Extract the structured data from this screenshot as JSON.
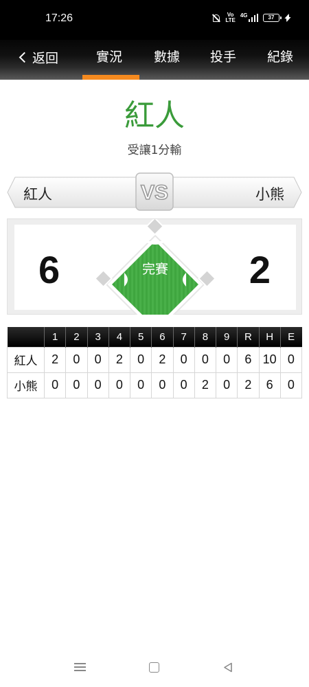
{
  "status_bar": {
    "time": "17:26",
    "volte_top": "Vo",
    "volte_bottom": "LTE",
    "network": "4G",
    "battery": "37"
  },
  "nav": {
    "back_label": "返回",
    "tabs": [
      {
        "label": "實況",
        "active": true
      },
      {
        "label": "數據",
        "active": false
      },
      {
        "label": "投手",
        "active": false
      },
      {
        "label": "紀錄",
        "active": false
      }
    ],
    "accent_color": "#f58a1f"
  },
  "game": {
    "winner": "紅人",
    "result_text": "受讓1分輸",
    "home_team": "紅人",
    "away_team": "小熊",
    "vs_label": "VS",
    "home_score": "6",
    "away_score": "2",
    "status": "完賽",
    "winner_color": "#3a9b3a",
    "field_color": "#3fa63f"
  },
  "linescore": {
    "headers": [
      "",
      "1",
      "2",
      "3",
      "4",
      "5",
      "6",
      "7",
      "8",
      "9",
      "R",
      "H",
      "E"
    ],
    "rows": [
      {
        "team": "紅人",
        "innings": [
          "2",
          "0",
          "0",
          "2",
          "0",
          "2",
          "0",
          "0",
          "0"
        ],
        "r": "6",
        "h": "10",
        "e": "0"
      },
      {
        "team": "小熊",
        "innings": [
          "0",
          "0",
          "0",
          "0",
          "0",
          "0",
          "0",
          "2",
          "0"
        ],
        "r": "2",
        "h": "6",
        "e": "0"
      }
    ]
  },
  "system_nav": {
    "icons": [
      "menu-icon",
      "home-icon",
      "back-icon"
    ]
  }
}
